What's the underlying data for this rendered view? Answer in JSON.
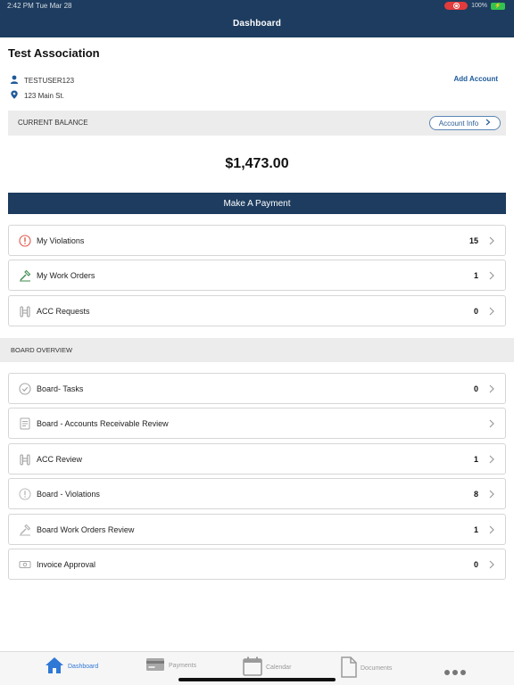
{
  "status_bar": {
    "time_date": "2:42 PM   Tue Mar 28",
    "battery": "100%"
  },
  "header": {
    "title": "Dashboard"
  },
  "association": {
    "name": "Test Association",
    "user": "TESTUSER123",
    "address": "123 Main St.",
    "add_account": "Add Account"
  },
  "balance": {
    "label": "CURRENT BALANCE",
    "account_info": "Account Info",
    "amount": "$1,473.00",
    "pay_button": "Make A Payment"
  },
  "my_items": [
    {
      "label": "My Violations",
      "count": "15",
      "icon": "alert-circle-icon"
    },
    {
      "label": "My Work Orders",
      "count": "1",
      "icon": "hammer-icon"
    },
    {
      "label": "ACC Requests",
      "count": "0",
      "icon": "fence-icon"
    }
  ],
  "board": {
    "section_label": "BOARD OVERVIEW",
    "items": [
      {
        "label": "Board- Tasks",
        "count": "0",
        "icon": "check-circle-icon"
      },
      {
        "label": "Board - Accounts Receivable Review",
        "count": "",
        "icon": "document-icon"
      },
      {
        "label": "ACC Review",
        "count": "1",
        "icon": "fence-icon"
      },
      {
        "label": "Board - Violations",
        "count": "8",
        "icon": "alert-circle-icon"
      },
      {
        "label": "Board Work Orders Review",
        "count": "1",
        "icon": "hammer-icon"
      },
      {
        "label": "Invoice Approval",
        "count": "0",
        "icon": "cash-icon"
      }
    ]
  },
  "tabbar": {
    "tabs": [
      {
        "label": "Dashboard",
        "icon": "home-icon",
        "active": true
      },
      {
        "label": "Payments",
        "icon": "card-icon",
        "active": false
      },
      {
        "label": "Calendar",
        "icon": "calendar-icon",
        "active": false
      },
      {
        "label": "Documents",
        "icon": "document-icon",
        "active": false
      }
    ],
    "more_icon": "more-dots-icon"
  },
  "colors": {
    "header": "#1d3c5f",
    "accent": "#1f5a9a",
    "active_tab": "#2f78d6",
    "violation_icon": "#e05a4a",
    "work_order_icon": "#3f8a4e"
  }
}
